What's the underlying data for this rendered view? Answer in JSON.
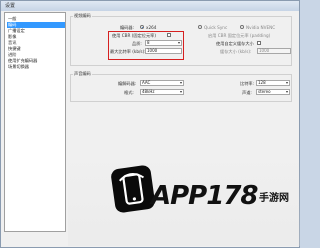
{
  "window": {
    "title": "设置"
  },
  "sidebar": {
    "items": [
      {
        "label": "一般"
      },
      {
        "label": "编码"
      },
      {
        "label": "广播设定"
      },
      {
        "label": "影像"
      },
      {
        "label": "音讯"
      },
      {
        "label": "快捷键"
      },
      {
        "label": "进阶"
      },
      {
        "label": "使用扩充编码器"
      },
      {
        "label": "场景切换器"
      }
    ]
  },
  "video_encoding": {
    "group_label": "视频编码",
    "encoder_label": "编码器:",
    "encoder_options": [
      "x264",
      "Quick Sync",
      "Nvidia NVENC"
    ],
    "cbr_label": "使用 CBR (固定位元率)",
    "cbr_padding_label": "启用 CBR 固定位元率 (padding)",
    "quality_label": "品质:",
    "quality_value": "8",
    "custom_buffer_label": "使用自定义缓存大小",
    "max_bitrate_label": "最大比特率 (kb/s):",
    "max_bitrate_value": "1000",
    "buffer_size_label": "缓存大小 (kb/s):",
    "buffer_size_value": "1000"
  },
  "audio_encoding": {
    "group_label": "声音编码",
    "codec_label": "编解码器:",
    "codec_value": "AAC",
    "bitrate_label": "比特率:",
    "bitrate_value": "128",
    "format_label": "格式:",
    "format_value": "48kHz",
    "channel_label": "声道:",
    "channel_value": "stereo"
  },
  "watermark": {
    "brand": "APP178",
    "sub": "手游网"
  }
}
